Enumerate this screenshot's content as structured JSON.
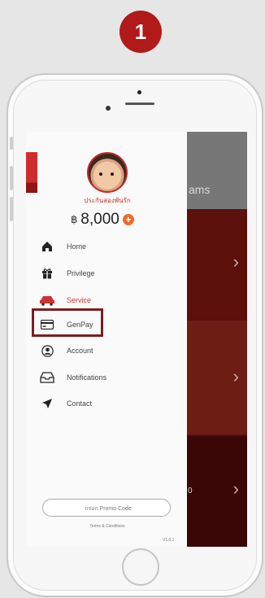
{
  "step_badge": "1",
  "main": {
    "header_text": "ams",
    "card3_text": "0",
    "chevron": "›"
  },
  "drawer": {
    "user_name": "ประกันสองพันรัก",
    "balance": "8,000",
    "coin_symbol": "฿",
    "menu": [
      {
        "label": "Home",
        "icon": "home-icon"
      },
      {
        "label": "Privilege",
        "icon": "gift-icon"
      },
      {
        "label": "Service",
        "icon": "service-icon"
      },
      {
        "label": "GenPay",
        "icon": "card-icon"
      },
      {
        "label": "Account",
        "icon": "account-icon"
      },
      {
        "label": "Notifications",
        "icon": "inbox-icon"
      },
      {
        "label": "Contact",
        "icon": "send-icon"
      }
    ],
    "highlighted_item": "GenPay",
    "promo_placeholder": "กรอก Promo Code",
    "terms": "Terms & Conditions",
    "version": "V1.0.1"
  },
  "colors": {
    "accent": "#b01a1a",
    "highlight_border": "#7e1d1d",
    "plus": "#ef6a2a"
  }
}
